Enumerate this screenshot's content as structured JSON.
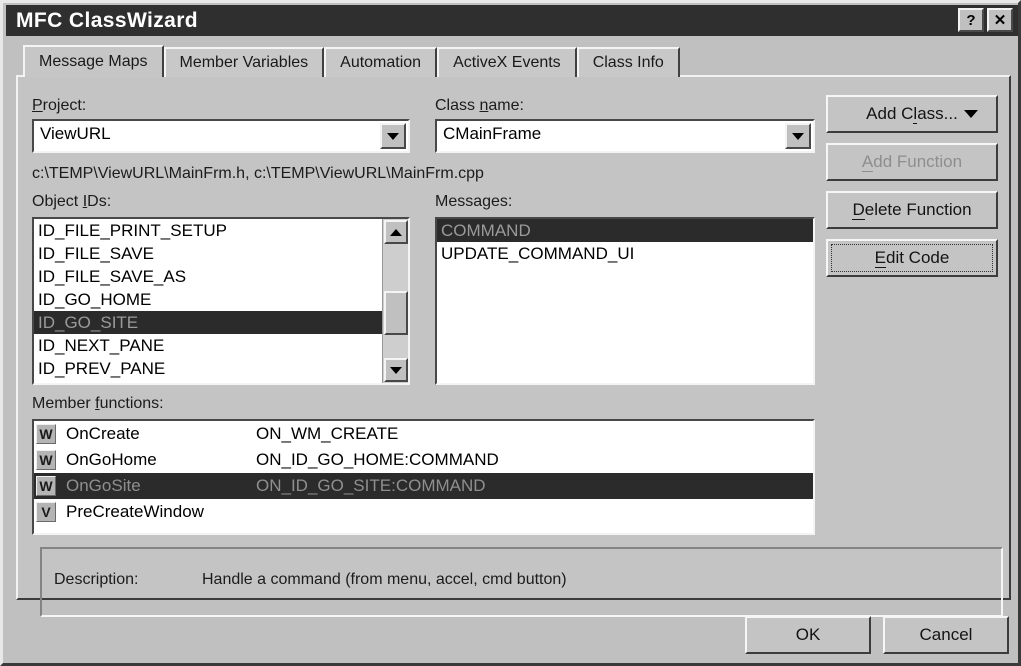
{
  "window": {
    "title": "MFC ClassWizard",
    "help_button": "?",
    "close_button": "✕"
  },
  "tabs": [
    {
      "label": "Message Maps",
      "active": true
    },
    {
      "label": "Member Variables",
      "active": false
    },
    {
      "label": "Automation",
      "active": false
    },
    {
      "label": "ActiveX Events",
      "active": false
    },
    {
      "label": "Class Info",
      "active": false
    }
  ],
  "project": {
    "label": "Project:",
    "value": "ViewURL"
  },
  "class_name": {
    "label": "Class name:",
    "value": "CMainFrame"
  },
  "file_paths": "c:\\TEMP\\ViewURL\\MainFrm.h, c:\\TEMP\\ViewURL\\MainFrm.cpp",
  "object_ids": {
    "label": "Object IDs:",
    "items": [
      {
        "text": "ID_FILE_PRINT_SETUP",
        "selected": false
      },
      {
        "text": "ID_FILE_SAVE",
        "selected": false
      },
      {
        "text": "ID_FILE_SAVE_AS",
        "selected": false
      },
      {
        "text": "ID_GO_HOME",
        "selected": false
      },
      {
        "text": "ID_GO_SITE",
        "selected": true
      },
      {
        "text": "ID_NEXT_PANE",
        "selected": false
      },
      {
        "text": "ID_PREV_PANE",
        "selected": false
      }
    ]
  },
  "messages": {
    "label": "Messages:",
    "items": [
      {
        "text": "COMMAND",
        "selected": true
      },
      {
        "text": "UPDATE_COMMAND_UI",
        "selected": false
      }
    ]
  },
  "member_functions": {
    "label": "Member functions:",
    "rows": [
      {
        "badge": "W",
        "name": "OnCreate",
        "message": "ON_WM_CREATE",
        "selected": false
      },
      {
        "badge": "W",
        "name": "OnGoHome",
        "message": "ON_ID_GO_HOME:COMMAND",
        "selected": false
      },
      {
        "badge": "W",
        "name": "OnGoSite",
        "message": "ON_ID_GO_SITE:COMMAND",
        "selected": true
      },
      {
        "badge": "V",
        "name": "PreCreateWindow",
        "message": "",
        "selected": false
      }
    ]
  },
  "side_buttons": {
    "add_class": "Add Class...",
    "add_function": "Add Function",
    "delete_function": "Delete Function",
    "edit_code": "Edit Code"
  },
  "description": {
    "label": "Description:",
    "text": "Handle a command (from menu, accel, cmd button)"
  },
  "dialog_buttons": {
    "ok": "OK",
    "cancel": "Cancel"
  },
  "colors": {
    "dialog_face": "#c0c0c0",
    "titlebar": "#2f2f2f",
    "selection": "#2b2b2b",
    "field_bg": "#ffffff"
  }
}
